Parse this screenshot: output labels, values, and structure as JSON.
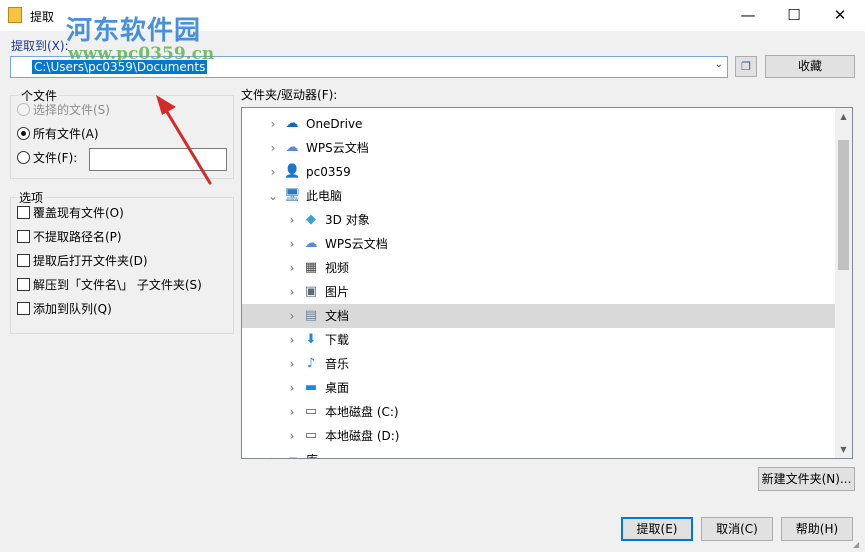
{
  "window": {
    "title": "提取",
    "controls": {
      "minimize": "—",
      "maximize": "☐",
      "close": "✕"
    }
  },
  "watermark": {
    "title": "河东软件园",
    "url": "www.pc0359.cn"
  },
  "destination": {
    "label": "提取到(X):",
    "path": "C:\\Users\\pc0359\\Documents",
    "dropdown_glyph": "⌄",
    "favorites_label": "收藏"
  },
  "files_group": {
    "legend": "个文件",
    "options": [
      {
        "label": "选择的文件(S)",
        "state": "disabled"
      },
      {
        "label": "所有文件(A)",
        "state": "selected"
      },
      {
        "label": "文件(F):",
        "state": "unselected"
      }
    ],
    "file_value": ""
  },
  "options_group": {
    "legend": "选项",
    "items": [
      {
        "label": "覆盖现有文件(O)",
        "checked": false
      },
      {
        "label": "不提取路径名(P)",
        "checked": false
      },
      {
        "label": "提取后打开文件夹(D)",
        "checked": false
      },
      {
        "label": "解压到「文件名\\」 子文件夹(S)",
        "checked": false
      },
      {
        "label": "添加到队列(Q)",
        "checked": false
      }
    ]
  },
  "tree": {
    "label": "文件夹/驱动器(F):",
    "items": [
      {
        "label": "OneDrive",
        "icon": "onedrive-icon",
        "level": 0,
        "expander": "›",
        "glyph": "☁",
        "color": "#0f6cbd"
      },
      {
        "label": "WPS云文档",
        "icon": "wps-cloud-icon",
        "level": 0,
        "expander": "›",
        "glyph": "☁",
        "color": "#5a8ad6"
      },
      {
        "label": "pc0359",
        "icon": "user-icon",
        "level": 0,
        "expander": "›",
        "glyph": "👤",
        "color": "#c47a2c"
      },
      {
        "label": "此电脑",
        "icon": "computer-icon",
        "level": 0,
        "expander": "⌄",
        "glyph": "🖥",
        "color": "#2b78c5"
      },
      {
        "label": "3D 对象",
        "icon": "3d-objects-icon",
        "level": 1,
        "expander": "›",
        "glyph": "◆",
        "color": "#3aa0d8"
      },
      {
        "label": "WPS云文档",
        "icon": "wps-cloud-icon",
        "level": 1,
        "expander": "›",
        "glyph": "☁",
        "color": "#5a8ad6"
      },
      {
        "label": "视频",
        "icon": "video-icon",
        "level": 1,
        "expander": "›",
        "glyph": "▦",
        "color": "#444"
      },
      {
        "label": "图片",
        "icon": "pictures-icon",
        "level": 1,
        "expander": "›",
        "glyph": "▣",
        "color": "#5a6b7a"
      },
      {
        "label": "文档",
        "icon": "documents-icon",
        "level": 1,
        "expander": "›",
        "glyph": "▤",
        "color": "#6a7f99",
        "selected": true
      },
      {
        "label": "下载",
        "icon": "download-icon",
        "level": 1,
        "expander": "›",
        "glyph": "⬇",
        "color": "#1e88e5"
      },
      {
        "label": "音乐",
        "icon": "music-icon",
        "level": 1,
        "expander": "›",
        "glyph": "♪",
        "color": "#1e88e5"
      },
      {
        "label": "桌面",
        "icon": "desktop-icon",
        "level": 1,
        "expander": "›",
        "glyph": "▬",
        "color": "#1e88e5"
      },
      {
        "label": "本地磁盘 (C:)",
        "icon": "drive-icon",
        "level": 1,
        "expander": "›",
        "glyph": "▭",
        "color": "#555"
      },
      {
        "label": "本地磁盘 (D:)",
        "icon": "drive-icon",
        "level": 1,
        "expander": "›",
        "glyph": "▭",
        "color": "#555"
      },
      {
        "label": "库",
        "icon": "folder-icon",
        "level": 0,
        "expander": "›",
        "glyph": "▰",
        "color": "#e6b94a"
      }
    ],
    "scroll_position": 0.08
  },
  "buttons": {
    "new_folder": "新建文件夹(N)...",
    "ok": "提取(E)",
    "cancel": "取消(C)",
    "help": "帮助(H)"
  },
  "accent_color": "#0078d7"
}
